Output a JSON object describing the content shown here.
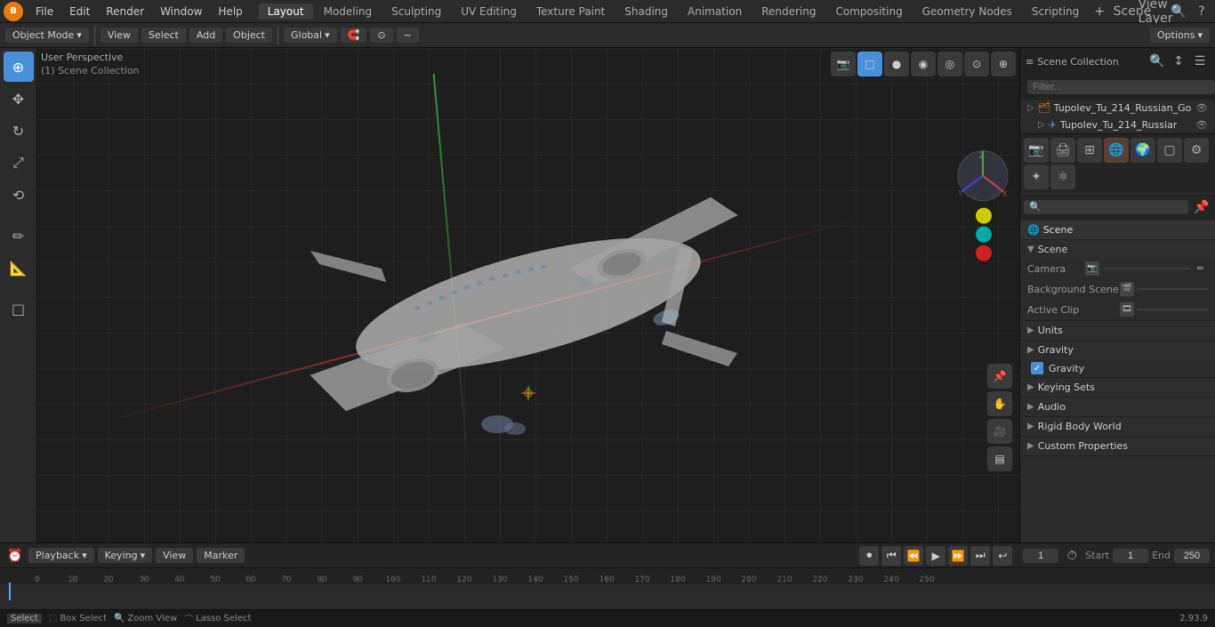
{
  "app": {
    "title": "Blender",
    "version": "2.93.9"
  },
  "menubar": {
    "items": [
      "File",
      "Edit",
      "Render",
      "Window",
      "Help"
    ],
    "logo": "B"
  },
  "workspace_tabs": [
    {
      "label": "Layout",
      "active": true
    },
    {
      "label": "Modeling",
      "active": false
    },
    {
      "label": "Sculpting",
      "active": false
    },
    {
      "label": "UV Editing",
      "active": false
    },
    {
      "label": "Texture Paint",
      "active": false
    },
    {
      "label": "Shading",
      "active": false
    },
    {
      "label": "Animation",
      "active": false
    },
    {
      "label": "Rendering",
      "active": false
    },
    {
      "label": "Compositing",
      "active": false
    },
    {
      "label": "Geometry Nodes",
      "active": false
    },
    {
      "label": "Scripting",
      "active": false
    }
  ],
  "header_scene": "Scene",
  "header_view_layer": "View Layer",
  "viewport": {
    "perspective_label": "User Perspective",
    "collection_label": "(1) Scene Collection",
    "transform_mode": "Global",
    "mode": "Object Mode"
  },
  "toolbar": {
    "view_label": "View",
    "select_label": "Select",
    "add_label": "Add",
    "object_label": "Object",
    "options_label": "Options"
  },
  "outliner": {
    "title": "Scene Collection",
    "items": [
      {
        "name": "Tupolev_Tu_214_Russian_Go",
        "icon": "▷",
        "depth": 0
      },
      {
        "name": "Tupolev_Tu_214_Russiar",
        "icon": "▷",
        "depth": 1
      }
    ]
  },
  "properties": {
    "scene_label": "Scene",
    "scene_section": "Scene",
    "camera_label": "Camera",
    "camera_value": "",
    "background_scene_label": "Background Scene",
    "active_clip_label": "Active Clip",
    "units_label": "Units",
    "gravity_label": "Gravity",
    "gravity_checked": true,
    "keying_sets_label": "Keying Sets",
    "audio_label": "Audio",
    "rigid_body_world_label": "Rigid Body World",
    "custom_properties_label": "Custom Properties"
  },
  "timeline": {
    "playback_label": "Playback",
    "keying_label": "Keying",
    "view_label": "View",
    "marker_label": "Marker",
    "frame_current": "1",
    "frame_start_label": "Start",
    "frame_start": "1",
    "frame_end_label": "End",
    "frame_end": "250",
    "ruler_marks": [
      "0",
      "10",
      "20",
      "30",
      "40",
      "50",
      "60",
      "70",
      "80",
      "90",
      "100",
      "110",
      "120",
      "130",
      "140",
      "150",
      "160",
      "170",
      "180",
      "190",
      "200",
      "210",
      "220",
      "230",
      "240",
      "250"
    ]
  },
  "statusbar": {
    "select_key": "Select",
    "box_select_key": "Box Select",
    "zoom_view_key": "Zoom View",
    "lasso_select_key": "Lasso Select",
    "version": "2.93.9"
  },
  "icons": {
    "cursor": "⊕",
    "move": "✥",
    "rotate": "↻",
    "scale": "⤢",
    "transform": "⟲",
    "annotate": "✏",
    "measure": "📐",
    "add_cube": "□",
    "play": "▶",
    "play_end": "⏭",
    "play_start": "⏮",
    "step_forward": "⏩",
    "step_back": "⏪",
    "record": "⏺",
    "loop": "🔁"
  }
}
